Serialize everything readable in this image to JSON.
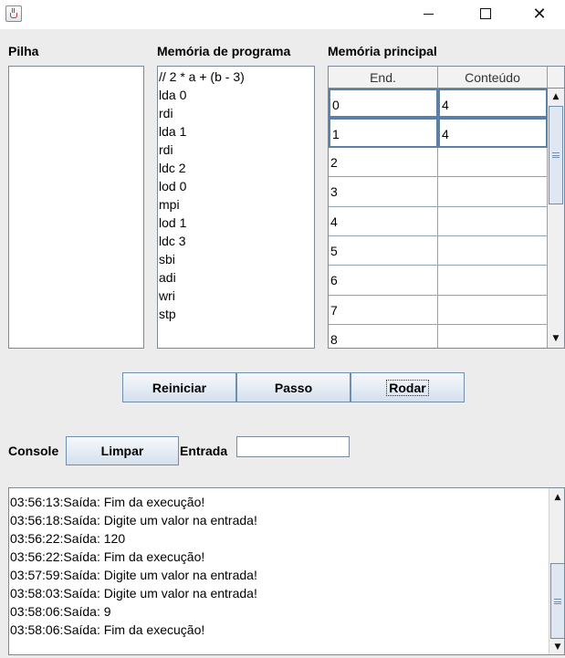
{
  "window": {
    "icon": "java-cup-icon",
    "controls": [
      "minimize-icon",
      "maximize-icon",
      "close-icon"
    ],
    "close_glyph": "✕"
  },
  "stack": {
    "label": "Pilha"
  },
  "program": {
    "label": "Memória de programa",
    "lines": [
      "// 2 * a + (b - 3)",
      "lda 0",
      "rdi",
      "lda 1",
      "rdi",
      "ldc 2",
      "lod 0",
      "mpi",
      "lod 1",
      "ldc 3",
      "sbi",
      "adi",
      "wri",
      "stp"
    ]
  },
  "memory": {
    "label": "Memória principal",
    "columns": [
      "End.",
      "Conteúdo"
    ],
    "rows": [
      {
        "addr": "0",
        "value": "4"
      },
      {
        "addr": "1",
        "value": "4"
      },
      {
        "addr": "2",
        "value": ""
      },
      {
        "addr": "3",
        "value": ""
      },
      {
        "addr": "4",
        "value": ""
      },
      {
        "addr": "5",
        "value": ""
      },
      {
        "addr": "6",
        "value": ""
      },
      {
        "addr": "7",
        "value": ""
      },
      {
        "addr": "8",
        "value": ""
      }
    ]
  },
  "controls": {
    "reset": "Reiniciar",
    "step": "Passo",
    "run": "Rodar"
  },
  "console": {
    "label": "Console",
    "clear": "Limpar",
    "input_label": "Entrada",
    "input_value": "",
    "log": [
      "03:56:13:Saída: Fim da execução!",
      "03:56:18:Saída: Digite um valor na entrada!",
      "03:56:22:Saída: 120",
      "03:56:22:Saída: Fim da execução!",
      "03:57:59:Saída: Digite um valor na entrada!",
      "03:58:03:Saída: Digite um valor na entrada!",
      "03:58:06:Saída: 9",
      "03:58:06:Saída: Fim da execução!"
    ]
  },
  "scroll": {
    "up": "▲",
    "down": "▼"
  }
}
